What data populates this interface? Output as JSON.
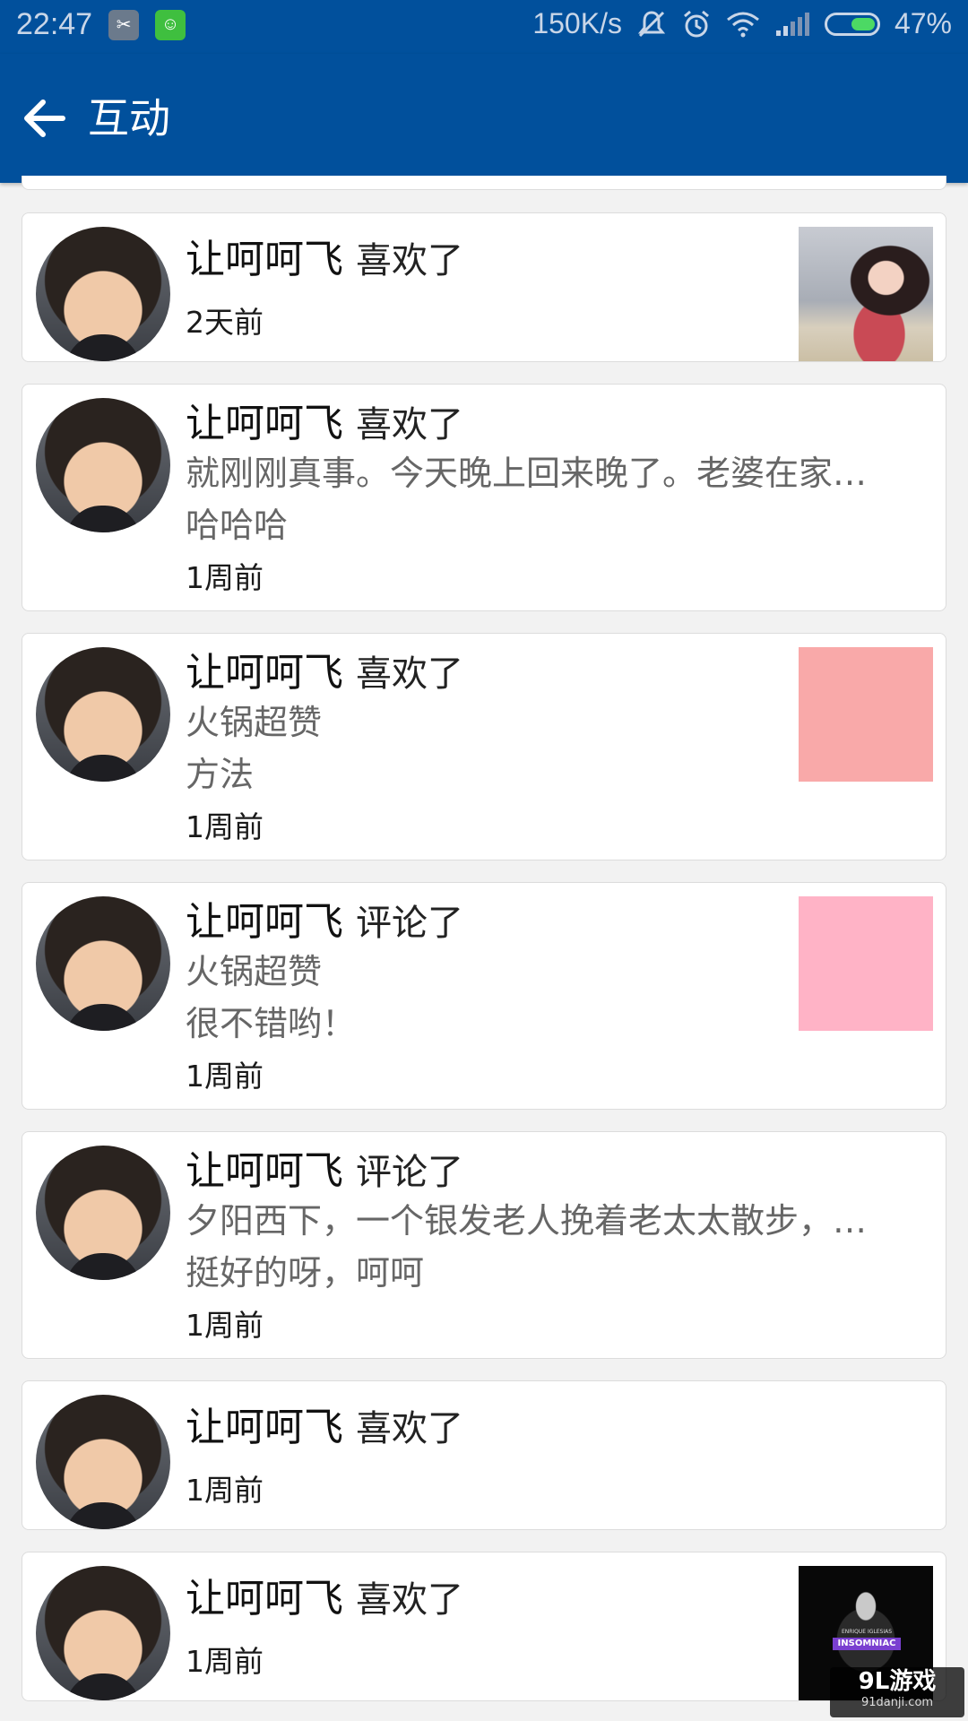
{
  "status_bar": {
    "time": "22:47",
    "speed": "150K/s",
    "battery_percent": "47%",
    "battery_level": 0.47,
    "icons": [
      "app-icon-1",
      "android-icon",
      "mute-icon",
      "alarm-icon",
      "wifi-icon",
      "signal-icon",
      "battery-icon"
    ]
  },
  "header": {
    "title": "互动",
    "back_icon": "arrow-left-icon",
    "color": "#01509c"
  },
  "items": [
    {
      "user": "让呵呵飞",
      "action": "喜欢了",
      "line2": "",
      "line3": "",
      "time": "2天前",
      "thumb": "photo"
    },
    {
      "user": "让呵呵飞",
      "action": "喜欢了",
      "line2": "就刚刚真事。今天晚上回来晚了。老婆在家…",
      "line3": "哈哈哈",
      "time": "1周前",
      "thumb": ""
    },
    {
      "user": "让呵呵飞",
      "action": "喜欢了",
      "line2": "火锅超赞",
      "line3": "方法",
      "time": "1周前",
      "thumb": "#f9a9a9"
    },
    {
      "user": "让呵呵飞",
      "action": "评论了",
      "line2": "火锅超赞",
      "line3": "很不错哟！",
      "time": "1周前",
      "thumb": "#ffb3c6"
    },
    {
      "user": "让呵呵飞",
      "action": "评论了",
      "line2": "夕阳西下，一个银发老人挽着老太太散步，…",
      "line3": "挺好的呀，呵呵",
      "time": "1周前",
      "thumb": ""
    },
    {
      "user": "让呵呵飞",
      "action": "喜欢了",
      "line2": "",
      "line3": "",
      "time": "1周前",
      "thumb": ""
    },
    {
      "user": "让呵呵飞",
      "action": "喜欢了",
      "line2": "",
      "line3": "",
      "time": "1周前",
      "thumb": "album"
    }
  ],
  "album_cover": {
    "artist": "ENRIQUE IGLESIAS",
    "title": "INSOMNIAC"
  },
  "watermark": {
    "main": "9L游戏",
    "sub": "91danji.com"
  }
}
